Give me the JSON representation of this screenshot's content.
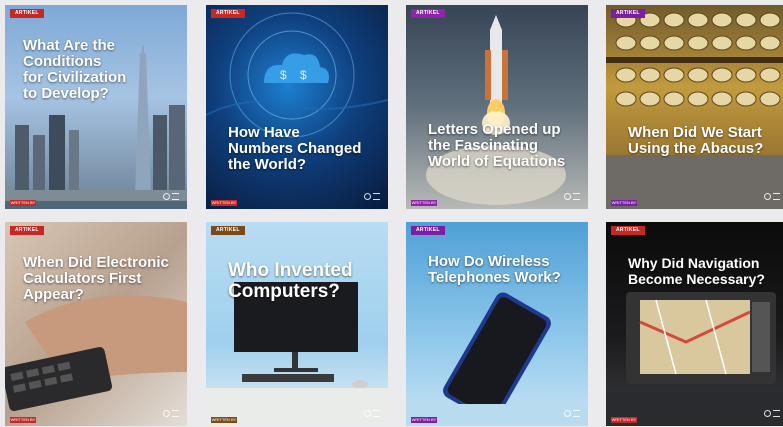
{
  "cards": [
    {
      "tag": "ARTIKEL",
      "title": "What Are the Conditions\nfor Civilization\nto Develop?",
      "footer": "WRITTEN BY",
      "tag_color": "#c62828"
    },
    {
      "tag": "ARTIKEL",
      "title": "How Have\nNumbers Changed\nthe World?",
      "footer": "WRITTEN BY",
      "tag_color": "#c62828"
    },
    {
      "tag": "ARTIKEL",
      "title": "Letters Opened up\nthe Fascinating\nWorld of Equations",
      "footer": "WRITTEN BY",
      "tag_color": "#8e24aa"
    },
    {
      "tag": "ARTIKEL",
      "title": "When Did We Start\nUsing the Abacus?",
      "footer": "WRITTEN BY",
      "tag_color": "#7b1fa2"
    },
    {
      "tag": "ARTIKEL",
      "title": "When Did Electronic\nCalculators First\nAppear?",
      "footer": "WRITTEN BY",
      "tag_color": "#c62828"
    },
    {
      "tag": "ARTIKEL",
      "title": "Who Invented\nComputers?",
      "footer": "WRITTEN BY",
      "tag_color": "#7a4b19"
    },
    {
      "tag": "ARTIKEL",
      "title": "How Do Wireless\nTelephones Work?",
      "footer": "WRITTEN BY",
      "tag_color": "#7b1fa2"
    },
    {
      "tag": "ARTIKEL",
      "title": "Why Did Navigation\nBecome Necessary?",
      "footer": "WRITTEN BY",
      "tag_color": "#c62828"
    }
  ]
}
